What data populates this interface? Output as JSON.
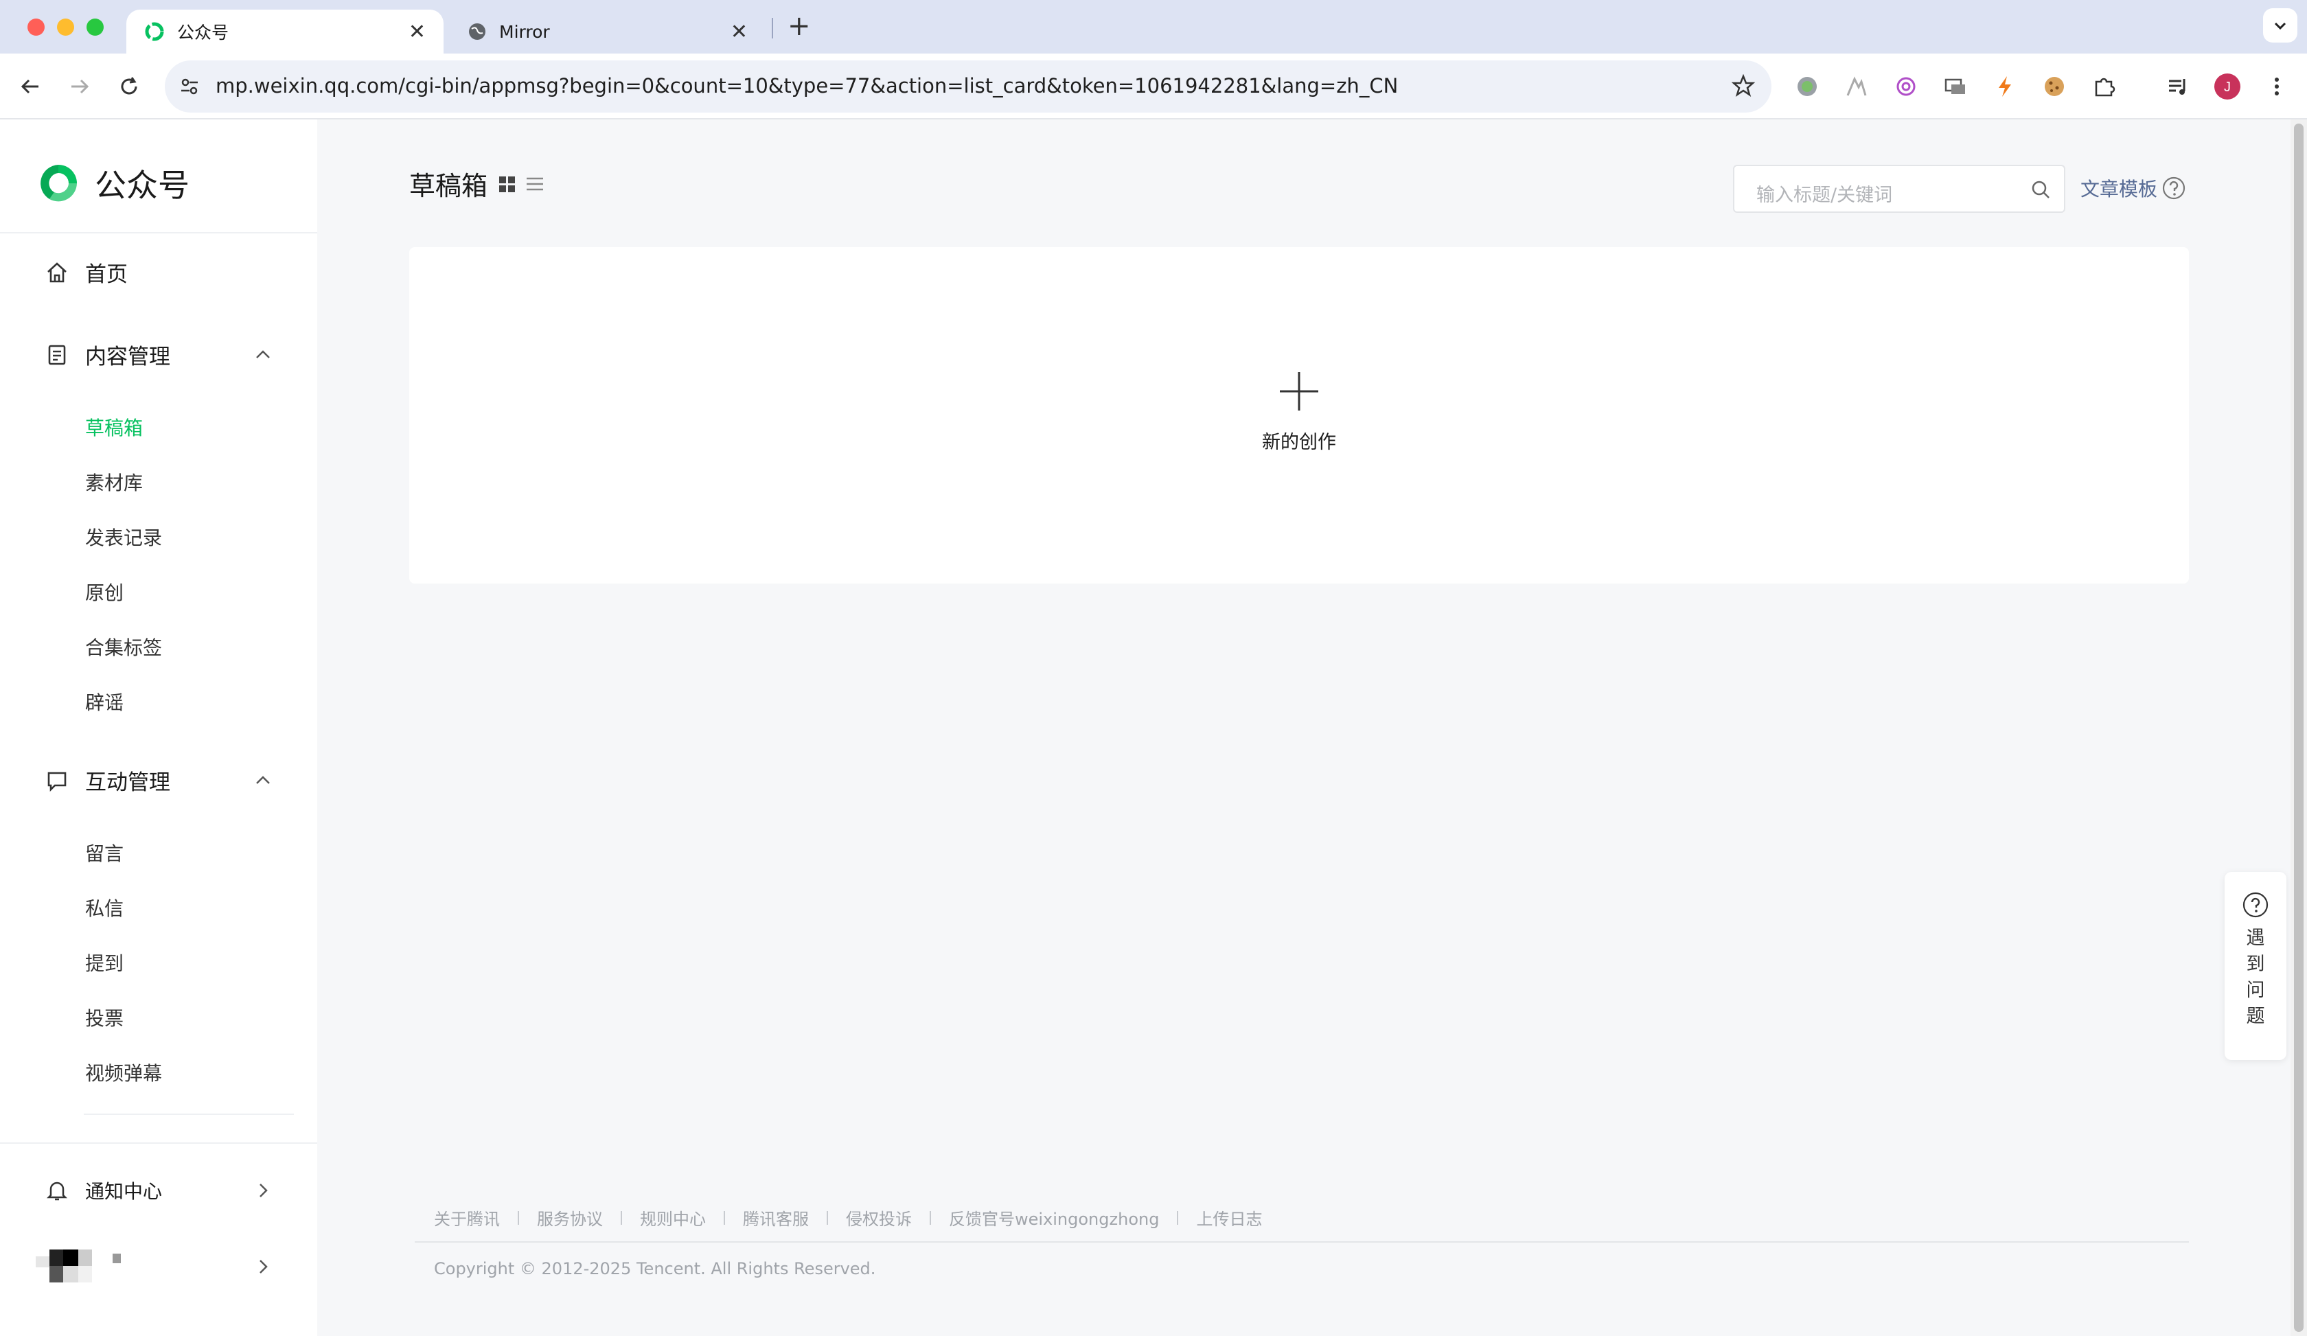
{
  "browser": {
    "tabs": [
      {
        "title": "公众号",
        "active": true
      },
      {
        "title": "Mirror",
        "active": false
      }
    ],
    "url": "mp.weixin.qq.com/cgi-bin/appmsg?begin=0&count=10&type=77&action=list_card&token=1061942281&lang=zh_CN",
    "profile_initial": "J"
  },
  "sidebar": {
    "logo_text": "公众号",
    "home": "首页",
    "content_group": {
      "label": "内容管理",
      "items": [
        "草稿箱",
        "素材库",
        "发表记录",
        "原创",
        "合集标签",
        "辟谣"
      ],
      "active": "草稿箱"
    },
    "interaction_group": {
      "label": "互动管理",
      "items": [
        "留言",
        "私信",
        "提到",
        "投票",
        "视频弹幕"
      ]
    },
    "notification": "通知中心"
  },
  "main": {
    "page_title": "草稿箱",
    "search_placeholder": "输入标题/关键词",
    "template_link": "文章模板",
    "create_label": "新的创作"
  },
  "footer": {
    "links": [
      "关于腾讯",
      "服务协议",
      "规则中心",
      "腾讯客服",
      "侵权投诉",
      "反馈官号weixingongzhong",
      "上传日志"
    ],
    "copyright": "Copyright © 2012-2025 Tencent. All Rights Reserved."
  },
  "help_float": {
    "label_chars": [
      "遇",
      "到",
      "问",
      "题"
    ]
  },
  "colors": {
    "accent_green": "#07c160",
    "link_blue": "#576b95",
    "tabbar_bg": "#dde3f3"
  }
}
